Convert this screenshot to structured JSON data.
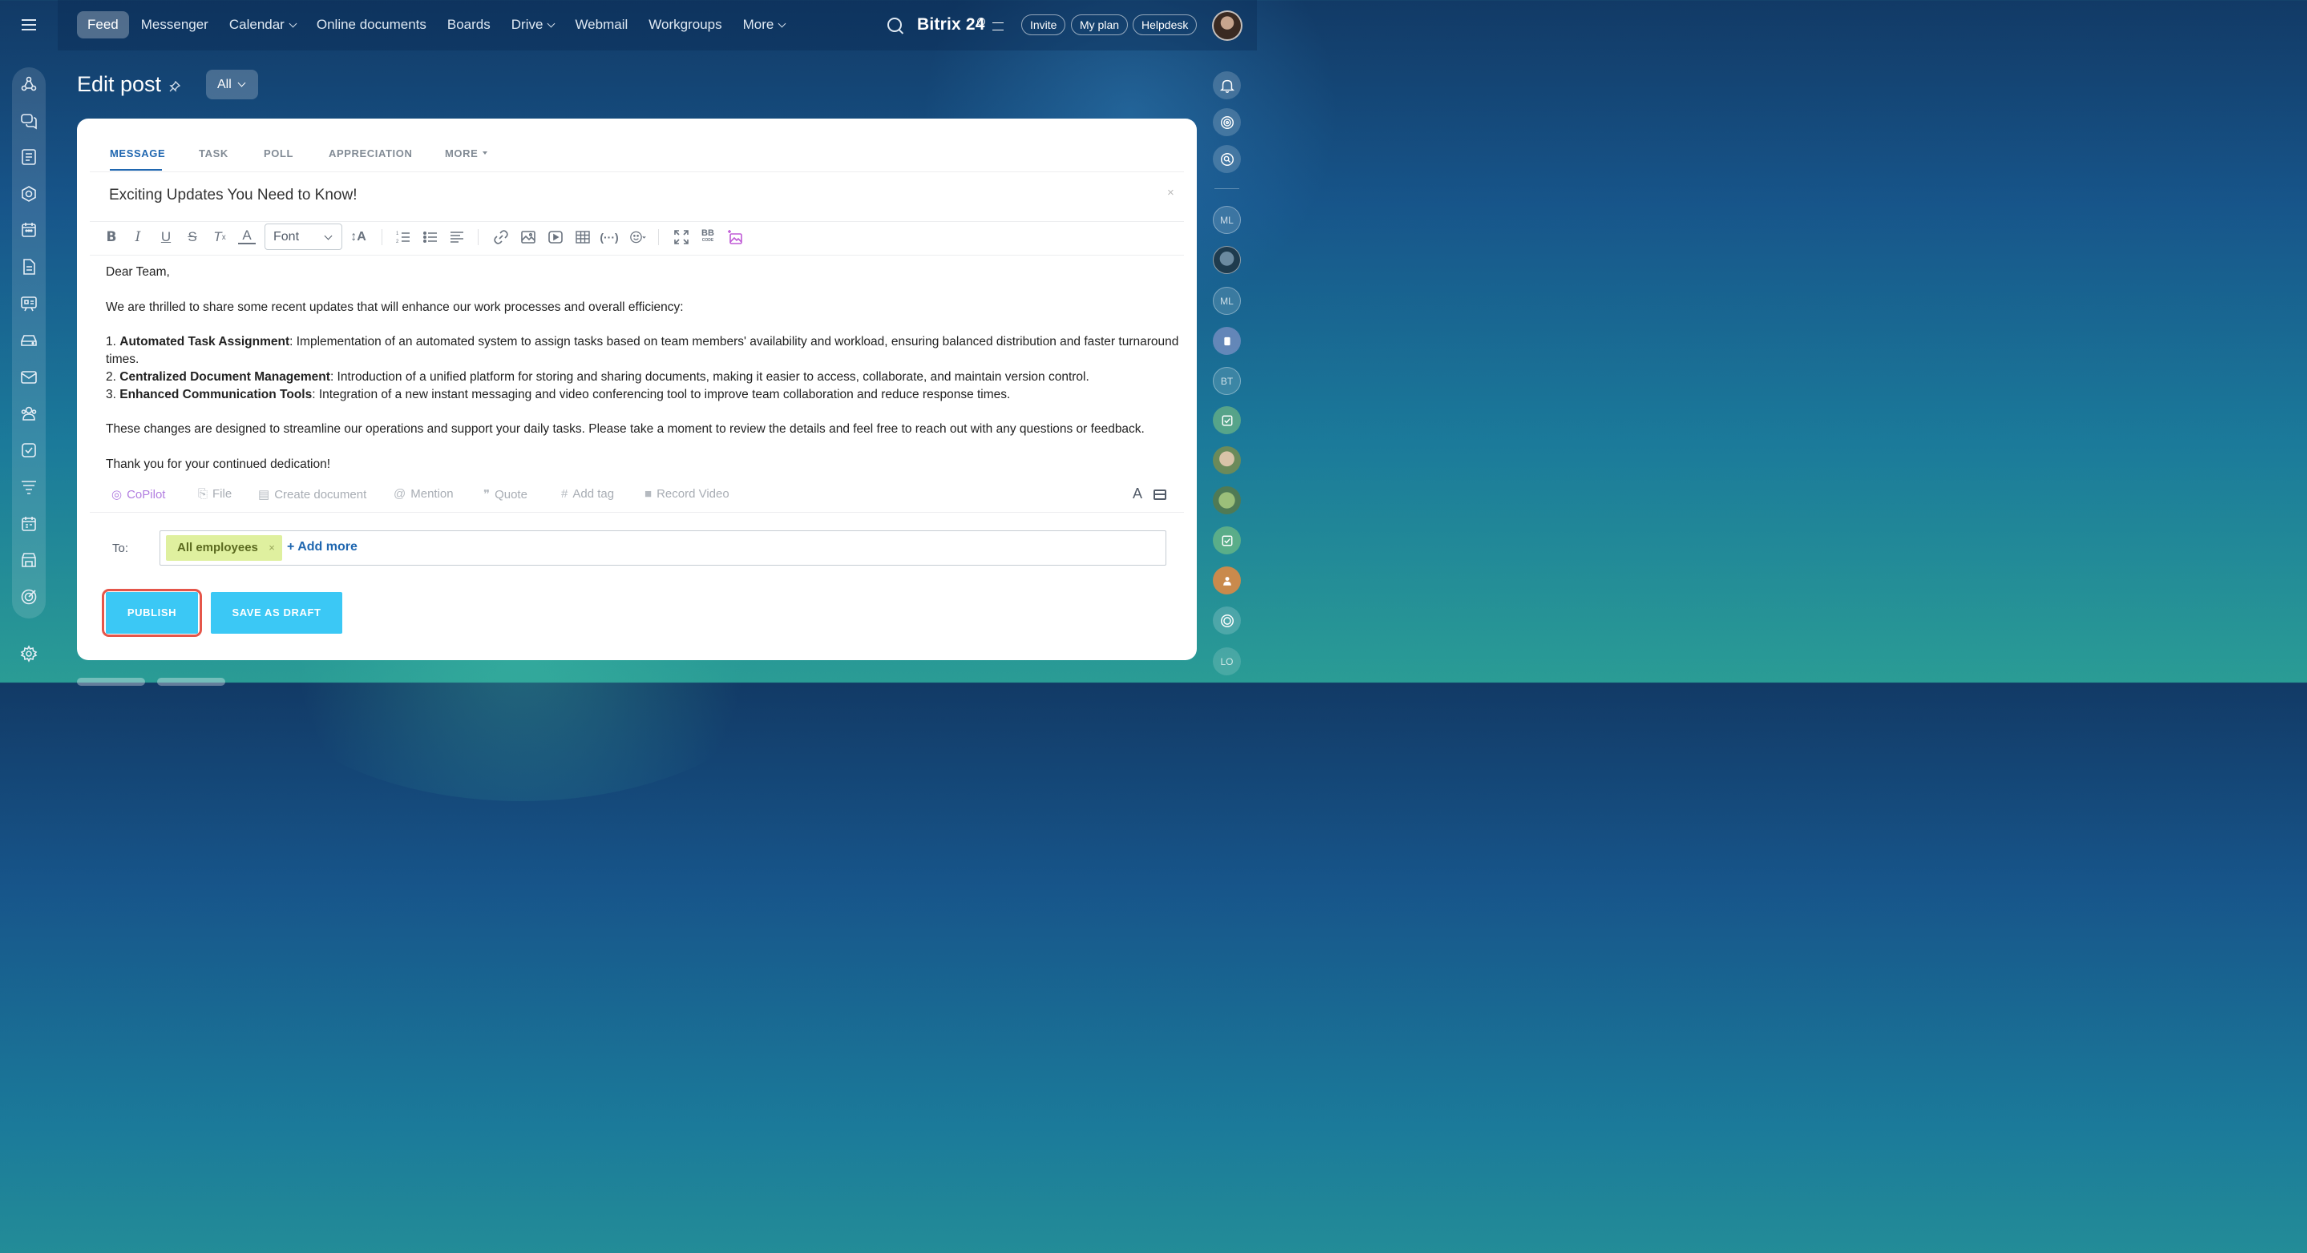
{
  "nav": {
    "items": [
      {
        "label": "Feed",
        "active": true,
        "dropdown": false
      },
      {
        "label": "Messenger",
        "active": false,
        "dropdown": false
      },
      {
        "label": "Calendar",
        "active": false,
        "dropdown": true
      },
      {
        "label": "Online documents",
        "active": false,
        "dropdown": false
      },
      {
        "label": "Boards",
        "active": false,
        "dropdown": false
      },
      {
        "label": "Drive",
        "active": false,
        "dropdown": true
      },
      {
        "label": "Webmail",
        "active": false,
        "dropdown": false
      },
      {
        "label": "Workgroups",
        "active": false,
        "dropdown": false
      },
      {
        "label": "More",
        "active": false,
        "dropdown": true
      }
    ],
    "brand": "Bitrix 24",
    "invite": "Invite",
    "my_plan": "My plan",
    "helpdesk": "Helpdesk"
  },
  "page": {
    "title": "Edit post",
    "filter": "All"
  },
  "composer": {
    "tabs": [
      "MESSAGE",
      "TASK",
      "POLL",
      "APPRECIATION",
      "MORE"
    ],
    "subject": "Exciting Updates You Need to Know!",
    "subject_clear": "×",
    "font_label": "Font",
    "body": {
      "greeting": "Dear Team,",
      "intro": "We are thrilled to share some recent updates that will enhance our work processes and overall efficiency:",
      "items": [
        {
          "num": "1.",
          "title": "Automated Task Assignment",
          "text": ": Implementation of an automated system to assign tasks based on team members' availability and workload, ensuring balanced distribution and faster turnaround times."
        },
        {
          "num": "2.",
          "title": "Centralized Document Management",
          "text": ": Introduction of a unified platform for storing and sharing documents, making it easier to access, collaborate, and maintain version control."
        },
        {
          "num": "3.",
          "title": "Enhanced Communication Tools",
          "text": ": Integration of a new instant messaging and video conferencing tool to improve team collaboration and reduce response times."
        }
      ],
      "closing": "These changes are designed to streamline our operations and support your daily tasks. Please take a moment to review the details and feel free to reach out with any questions or feedback.",
      "signoff": "Thank you for your continued dedication!"
    },
    "footer": {
      "copilot": "CoPilot",
      "file": "File",
      "create_document": "Create document",
      "mention": "Mention",
      "quote": "Quote",
      "add_tag": "Add tag",
      "record_video": "Record Video",
      "format_letter": "A"
    },
    "to_label": "To:",
    "recipient": "All employees",
    "recipient_remove": "×",
    "add_more": "+ Add more",
    "publish": "PUBLISH",
    "save_draft": "SAVE AS DRAFT"
  },
  "right_sidebar": {
    "avatars": [
      "ML",
      "ML",
      "BT",
      "LO"
    ]
  },
  "colors": {
    "accent": "#3bc8f5",
    "link": "#2067b0",
    "tag_bg": "#dff09f",
    "highlight_ring": "#e5564a",
    "copilot": "#b17de0"
  }
}
